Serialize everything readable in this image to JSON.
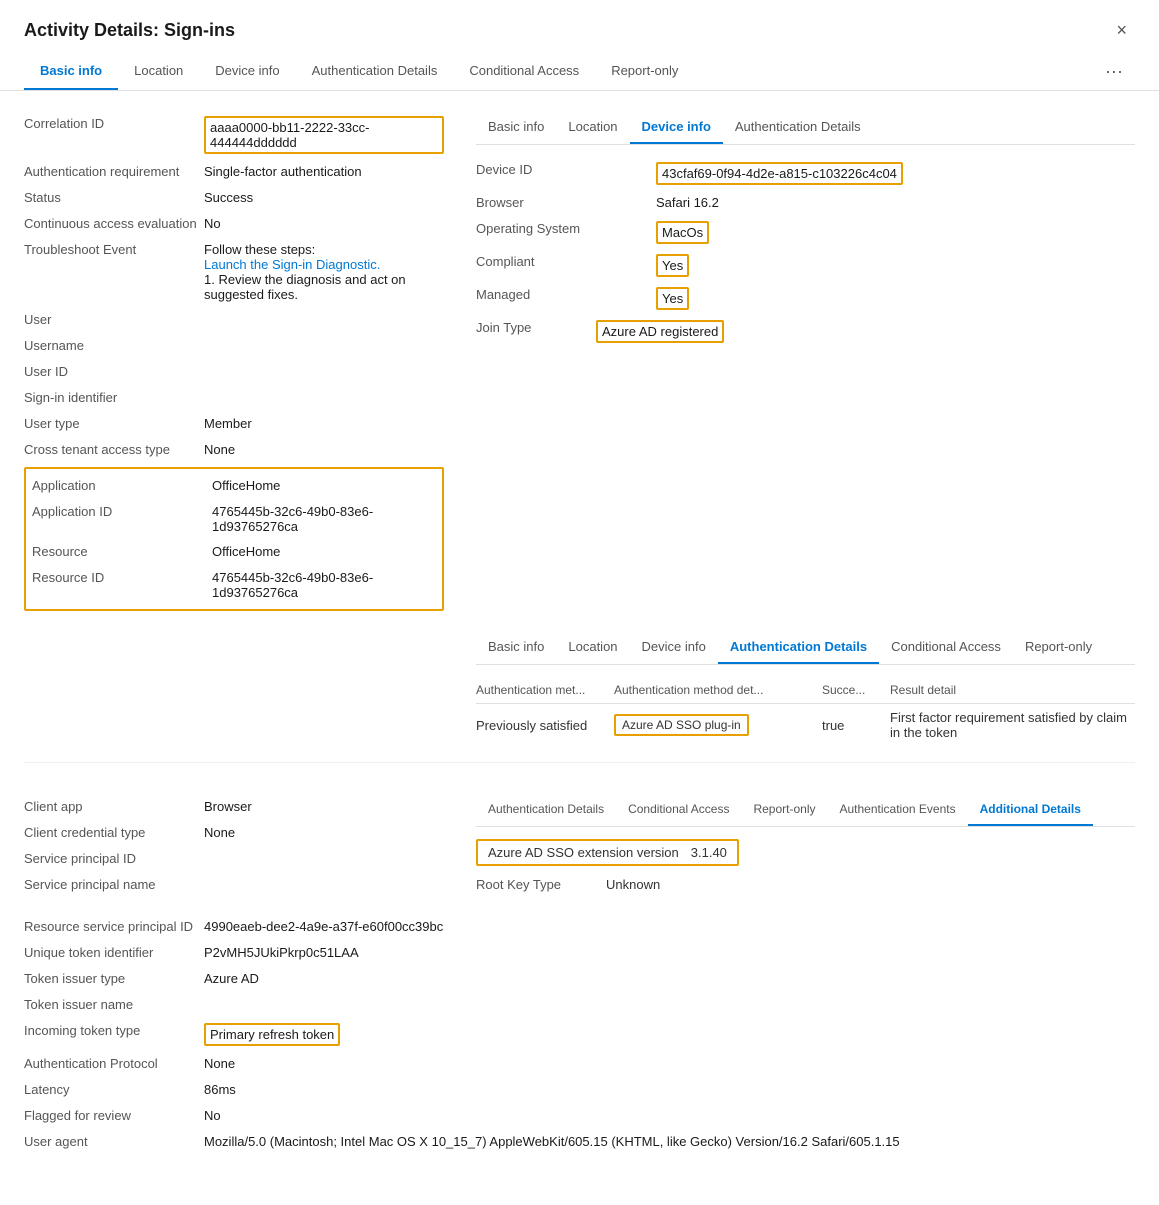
{
  "modal": {
    "title": "Activity Details: Sign-ins",
    "close_label": "×"
  },
  "main_tabs": [
    {
      "label": "Basic info",
      "active": true
    },
    {
      "label": "Location",
      "active": false
    },
    {
      "label": "Device info",
      "active": false
    },
    {
      "label": "Authentication Details",
      "active": false
    },
    {
      "label": "Conditional Access",
      "active": false
    },
    {
      "label": "Report-only",
      "active": false
    }
  ],
  "basic_info": {
    "rows": [
      {
        "label": "Correlation ID",
        "value": "aaaa0000-bb11-2222-33cc-444444dddddd",
        "highlighted": true
      },
      {
        "label": "Authentication requirement",
        "value": "Single-factor authentication"
      },
      {
        "label": "Status",
        "value": "Success"
      },
      {
        "label": "Continuous access evaluation",
        "value": "No"
      },
      {
        "label": "Troubleshoot Event",
        "value_html": true,
        "value": "Follow these steps:",
        "link": "Launch the Sign-in Diagnostic.",
        "extra": "1. Review the diagnosis and act on suggested fixes."
      },
      {
        "label": "User",
        "value": ""
      },
      {
        "label": "Username",
        "value": ""
      },
      {
        "label": "User ID",
        "value": ""
      },
      {
        "label": "Sign-in identifier",
        "value": ""
      },
      {
        "label": "User type",
        "value": "Member"
      },
      {
        "label": "Cross tenant access type",
        "value": "None"
      },
      {
        "label": "Application",
        "value": "OfficeHome",
        "highlighted": true
      },
      {
        "label": "Application ID",
        "value": "4765445b-32c6-49b0-83e6-1d93765276ca",
        "highlighted": true
      },
      {
        "label": "Resource",
        "value": "OfficeHome",
        "highlighted": true
      },
      {
        "label": "Resource ID",
        "value": "4765445b-32c6-49b0-83e6-1d93765276ca",
        "highlighted": true
      }
    ]
  },
  "right_panel_top": {
    "tabs": [
      {
        "label": "Basic info"
      },
      {
        "label": "Location"
      },
      {
        "label": "Device info",
        "active": true
      },
      {
        "label": "Authentication Details"
      }
    ],
    "device_rows": [
      {
        "label": "Device ID",
        "value": "43cfaf69-0f94-4d2e-a815-c103226c4c04",
        "highlighted": true
      },
      {
        "label": "Browser",
        "value": "Safari 16.2"
      },
      {
        "label": "Operating System",
        "value": "MacOs",
        "highlighted": true
      },
      {
        "label": "Compliant",
        "value": "Yes",
        "highlighted": true
      },
      {
        "label": "Managed",
        "value": "Yes",
        "highlighted": true
      },
      {
        "label": "Join Type",
        "value": "Azure AD registered",
        "highlighted": true
      }
    ]
  },
  "right_panel_auth": {
    "tabs": [
      {
        "label": "Basic info"
      },
      {
        "label": "Location"
      },
      {
        "label": "Device info"
      },
      {
        "label": "Authentication Details",
        "active": true
      },
      {
        "label": "Conditional Access"
      },
      {
        "label": "Report-only"
      }
    ],
    "table_headers": [
      "Authentication met...",
      "Authentication method det...",
      "Succe...",
      "Result detail"
    ],
    "table_rows": [
      {
        "auth_method": "Previously satisfied",
        "auth_detail": "Azure AD SSO plug-in",
        "auth_detail_highlighted": true,
        "success": "true",
        "result": "First factor requirement satisfied by claim in the token"
      }
    ]
  },
  "bottom_left": {
    "rows": [
      {
        "label": "Client app",
        "value": "Browser"
      },
      {
        "label": "Client credential type",
        "value": "None"
      },
      {
        "label": "Service principal ID",
        "value": ""
      },
      {
        "label": "Service principal name",
        "value": ""
      }
    ]
  },
  "right_panel_additional": {
    "tabs": [
      {
        "label": "Authentication Details"
      },
      {
        "label": "Conditional Access"
      },
      {
        "label": "Report-only"
      },
      {
        "label": "Authentication Events"
      },
      {
        "label": "Additional Details",
        "active": true
      }
    ],
    "sso_version_label": "Azure AD SSO extension version",
    "sso_version_value": "3.1.40",
    "root_key_label": "Root Key Type",
    "root_key_value": "Unknown"
  },
  "extra_info": {
    "rows": [
      {
        "label": "Resource service principal ID",
        "value": "4990eaeb-dee2-4a9e-a37f-e60f00cc39bc"
      },
      {
        "label": "Unique token identifier",
        "value": "P2vMH5JUkiPkrp0c51LAA"
      },
      {
        "label": "Token issuer type",
        "value": "Azure AD"
      },
      {
        "label": "Token issuer name",
        "value": ""
      },
      {
        "label": "Incoming token type",
        "value": "Primary refresh token",
        "highlighted": true
      },
      {
        "label": "Authentication Protocol",
        "value": "None"
      },
      {
        "label": "Latency",
        "value": "86ms"
      },
      {
        "label": "Flagged for review",
        "value": "No"
      },
      {
        "label": "User agent",
        "value": "Mozilla/5.0 (Macintosh; Intel Mac OS X 10_15_7) AppleWebKit/605.15 (KHTML, like Gecko) Version/16.2 Safari/605.1.15"
      }
    ]
  }
}
